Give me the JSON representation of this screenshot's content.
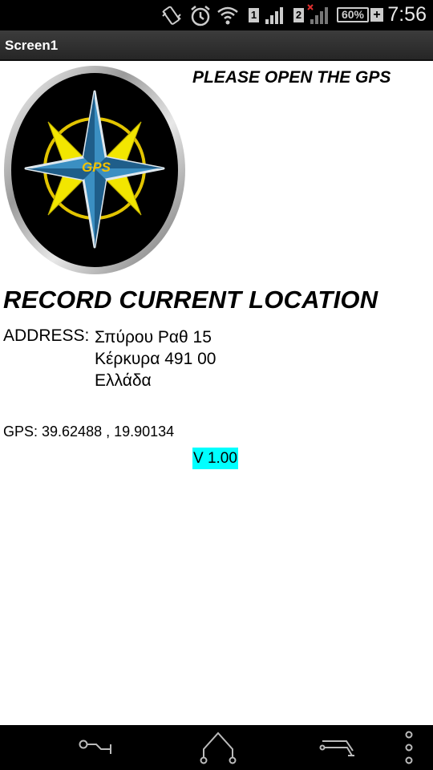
{
  "status_bar": {
    "time": "7:56",
    "battery_percent": "60%",
    "sim1_label": "1",
    "sim2_label": "2",
    "icons": [
      "vibrate-icon",
      "alarm-icon",
      "wifi-icon",
      "signal-icon",
      "battery-icon"
    ]
  },
  "app": {
    "title": "Screen1"
  },
  "main": {
    "logo_text": "GPS",
    "gps_hint": "PLEASE OPEN THE GPS",
    "heading": "RECORD CURRENT LOCATION",
    "address_label": "ADDRESS:",
    "address_lines": [
      "Σπύρου Ραθ 15",
      "Κέρκυρα 491 00",
      "Ελλάδα"
    ],
    "gps_text": "GPS: 39.62488 , 19.90134",
    "version": "V 1.00"
  },
  "nav_bar": {
    "icons": [
      "back-icon",
      "home-icon",
      "recents-icon",
      "menu-icon"
    ]
  },
  "colors": {
    "version_bg": "#00ffff",
    "logo_star": "#3b8fc2",
    "logo_yellow": "#f2e600"
  }
}
